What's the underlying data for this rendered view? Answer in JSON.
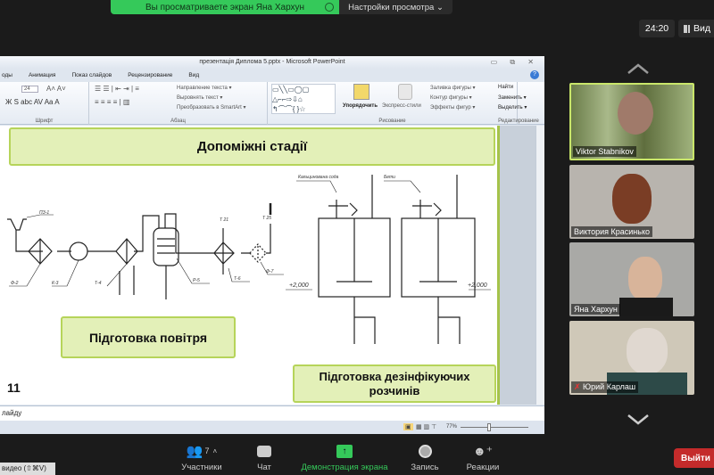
{
  "banner": {
    "text": "Вы просматриваете экран Яна Xархун",
    "settings": "Настройки просмотра ⌄"
  },
  "header": {
    "timer": "24:20",
    "view": "Вид"
  },
  "ppt": {
    "title": "презентація Диплома 5.pptx - Microsoft PowerPoint",
    "tabs": [
      "оды",
      "Анимация",
      "Показ слайдов",
      "Рецензирование",
      "Вид"
    ],
    "groups": {
      "font": "Шрифт",
      "paragraph": "Абзац",
      "drawing": "Рисование",
      "editing": "Редактирование"
    },
    "font_size": "24",
    "ribbon": {
      "text_direction": "Направление текста ▾",
      "align_text": "Выровнять текст ▾",
      "smartart": "Преобразовать в SmartArt ▾",
      "arrange": "Упорядочить",
      "quick_styles": "Экспресс-стили",
      "fill": "Заливка фигуры ▾",
      "outline": "Контур фигуры ▾",
      "effects": "Эффекты фигур ▾",
      "find": "Найти",
      "replace": "Заменить ▾",
      "select": "Выделить ▾"
    },
    "slide": {
      "heading": "Допоміжні стадії",
      "box_air": "Підготовка повітря",
      "box_disinfect": "Підготовка дезінфікуючих розчинів",
      "number": "11",
      "air_labels": {
        "pz1": "ПЗ-1",
        "f2": "Ф-2",
        "k3": "К-3",
        "t4": "Т-4",
        "r5": "Р-5",
        "t6": "Т-6",
        "f7": "Ф-7",
        "t21": "Т 21",
        "t25": "Т 25"
      },
      "disinfect_labels": {
        "soda": "Кальцинована сода",
        "beta": "Бети",
        "level_left": "+2,000",
        "level_right": "+2,000"
      }
    },
    "notes": "лайду",
    "zoom": "77%"
  },
  "participants": [
    {
      "name": "Viktor Stabnikov",
      "active": true
    },
    {
      "name": "Виктория Красинько"
    },
    {
      "name": "Яна Xархун"
    },
    {
      "name": "Юрий Карлаш",
      "muted": true
    }
  ],
  "toolbar": {
    "participants": "Участники",
    "participants_count": "7",
    "chat": "Чат",
    "share": "Демонстрация экрана",
    "record": "Запись",
    "reactions": "Реакции",
    "exit": "Выйти",
    "video_hint": "видео (⇧⌘V)"
  },
  "colors": {
    "share_green": "#35c95a",
    "exit_red": "#c42b2b",
    "slide_green": "#b6d45a"
  }
}
